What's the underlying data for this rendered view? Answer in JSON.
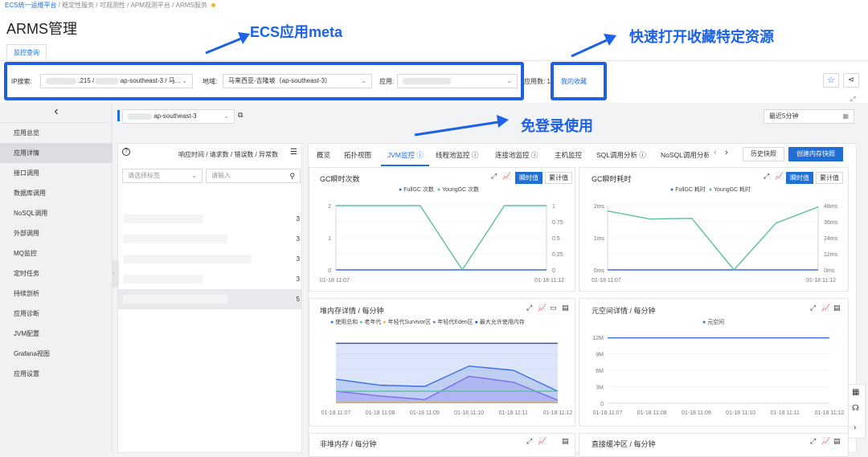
{
  "breadcrumb": {
    "b1": "ECS统一运维平台",
    "b2": "稳定性服务",
    "b3": "可观测性",
    "b4": "APM观测平台",
    "b5": "ARMS服务",
    "sep": "/"
  },
  "page_title": "ARMS管理",
  "tab": "监控查询",
  "filter": {
    "ip_label": "IP搜索:",
    "ip_value": ".215 /",
    "ip_region": "ap-southeast-3 / 马...",
    "region_label": "地域:",
    "region_value": "马来西亚-吉隆坡（ap-southeast-3）",
    "app_label": "应用:",
    "app_count_label": "应用数: 1",
    "favorites": "我的收藏"
  },
  "annotations": {
    "a1": "ECS应用meta",
    "a2": "快速打开收藏特定资源",
    "a3": "免登录使用"
  },
  "sidebar": {
    "collapse": "‹",
    "items": [
      "应用总览",
      "应用详情",
      "接口调用",
      "数据库调用",
      "NoSQL调用",
      "外部调用",
      "MQ监控",
      "定时任务",
      "持续剖析",
      "应用诊断",
      "JVM配置",
      "Grafana视图",
      "应用设置"
    ]
  },
  "toolbar": {
    "region": "ap-southeast-3",
    "time_range": "最近5分钟"
  },
  "list_panel": {
    "help": "?",
    "metrics": "响应时间 / 请求数 / 错误数 / 异常数",
    "tag_placeholder": "请选择标签",
    "search_placeholder": "请输入",
    "counts": [
      "3",
      "3",
      "3",
      "3",
      "5"
    ]
  },
  "tabs": [
    "概览",
    "拓扑视图",
    "JVM监控",
    "线程池监控",
    "连接池监控",
    "主机监控",
    "SQL调用分析",
    "NoSQL调用分析"
  ],
  "actions": {
    "history": "历史快照",
    "create": "创建内存快照"
  },
  "gc_count": {
    "title": "GC瞬时次数",
    "instant": "瞬时值",
    "cumulative": "累计值",
    "legend": [
      "FullGC 次数",
      "YoungGC 次数"
    ],
    "y_left": [
      "2",
      "1",
      "0"
    ],
    "y_right": [
      "1",
      "0.75",
      "0.5",
      "0.25",
      "0"
    ],
    "x": [
      "01-18 11:07",
      "01-18 11:12"
    ]
  },
  "gc_time": {
    "title": "GC瞬时耗时",
    "instant": "瞬时值",
    "cumulative": "累计值",
    "legend": [
      "FullGC 耗时",
      "YoungGC 耗时"
    ],
    "y_left": [
      "2ms",
      "1ms",
      "0ms"
    ],
    "y_right": [
      "48ms",
      "36ms",
      "24ms",
      "12ms",
      "0ms"
    ],
    "x": [
      "01-18 11:07",
      "01-18 11:12"
    ]
  },
  "heap": {
    "title": "堆内存详情 / 每分钟",
    "legend": [
      "使用总和",
      "老年代",
      "年轻代Survivor区",
      "年轻代Eden区",
      "最大允许使用内存"
    ],
    "x": [
      "01-18 11:07",
      "01-18 11:08",
      "01-18 11:09",
      "01-18 11:10",
      "01-18 11:11",
      "01-18 11:12"
    ]
  },
  "meta": {
    "title": "元空间详情 / 每分钟",
    "legend": [
      "元空间"
    ],
    "y": [
      "12M",
      "9M",
      "6M",
      "3M",
      "0"
    ],
    "x": [
      "01-18 11:07",
      "01-18 11:08",
      "01-18 11:09",
      "01-18 11:10",
      "01-18 11:11",
      "01-18 11:12"
    ]
  },
  "bottom": {
    "left": "非堆内存 / 每分钟",
    "right": "直接缓冲区 / 每分钟"
  },
  "colors": {
    "accent": "#1f6fd6",
    "annotation": "#1b62e6",
    "green": "#5cc09a",
    "blue": "#3b6fe0",
    "purple": "#7a6ee6",
    "yellow": "#f0b32b"
  },
  "chart_data": [
    {
      "type": "line",
      "title": "GC瞬时次数",
      "x": [
        "01-18 11:07",
        "01-18 11:08",
        "01-18 11:09",
        "01-18 11:10",
        "01-18 11:11",
        "01-18 11:12"
      ],
      "series": [
        {
          "name": "FullGC 次数",
          "values": [
            0,
            0,
            0,
            0,
            0,
            0
          ]
        },
        {
          "name": "YoungGC 次数",
          "values": [
            2,
            2,
            2,
            0,
            2,
            2
          ]
        }
      ],
      "ylim": [
        0,
        2
      ]
    },
    {
      "type": "line",
      "title": "GC瞬时耗时",
      "x": [
        "01-18 11:07",
        "01-18 11:08",
        "01-18 11:09",
        "01-18 11:10",
        "01-18 11:11",
        "01-18 11:12"
      ],
      "series": [
        {
          "name": "FullGC 耗时",
          "values": [
            0,
            0,
            0,
            0,
            0,
            0
          ]
        },
        {
          "name": "YoungGC 耗时",
          "values": [
            44,
            38,
            38.5,
            0,
            35,
            47
          ]
        }
      ],
      "y_unit": "ms"
    },
    {
      "type": "area",
      "title": "堆内存详情 / 每分钟",
      "x": [
        "01-18 11:07",
        "01-18 11:08",
        "01-18 11:09",
        "01-18 11:10",
        "01-18 11:11",
        "01-18 11:12"
      ],
      "series": [
        {
          "name": "使用总和",
          "values": [
            0.4,
            0.3,
            0.28,
            0.62,
            0.55,
            0.2
          ]
        },
        {
          "name": "老年代",
          "values": [
            0.2,
            0.2,
            0.2,
            0.2,
            0.2,
            0.2
          ]
        },
        {
          "name": "年轻代Survivor区",
          "values": [
            0.01,
            0.01,
            0.01,
            0.01,
            0.01,
            0.01
          ]
        },
        {
          "name": "年轻代Eden区",
          "values": [
            0.2,
            0.12,
            0.06,
            0.45,
            0.35,
            0.05
          ]
        },
        {
          "name": "最大允许使用内存",
          "values": [
            1,
            1,
            1,
            1,
            1,
            1
          ]
        }
      ]
    },
    {
      "type": "line",
      "title": "元空间详情 / 每分钟",
      "x": [
        "01-18 11:07",
        "01-18 11:08",
        "01-18 11:09",
        "01-18 11:10",
        "01-18 11:11",
        "01-18 11:12"
      ],
      "series": [
        {
          "name": "元空间",
          "values": [
            11.9,
            11.9,
            11.9,
            11.9,
            11.9,
            11.9
          ]
        }
      ],
      "ylim": [
        0,
        12
      ],
      "y_unit": "M"
    }
  ]
}
